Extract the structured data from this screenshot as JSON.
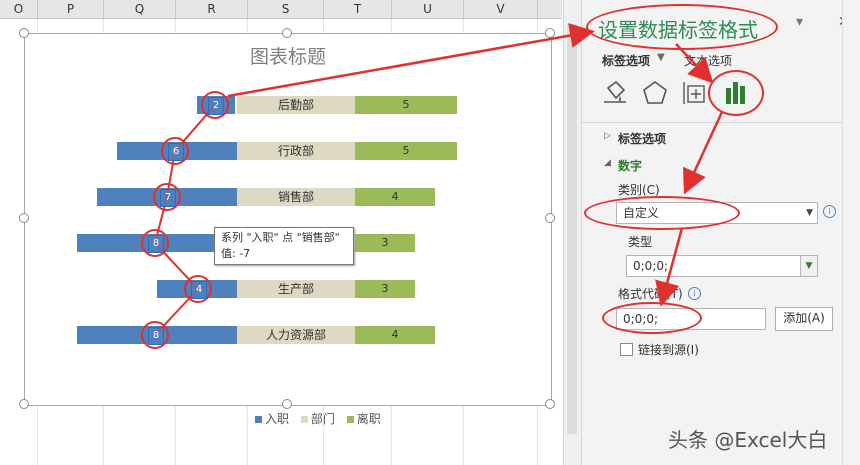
{
  "columns": [
    "O",
    "P",
    "Q",
    "R",
    "S",
    "T",
    "U",
    "V"
  ],
  "chart": {
    "title": "图表标题",
    "departments": [
      "后勤部",
      "行政部",
      "销售部",
      "生产部",
      "人力资源部"
    ],
    "rows": [
      {
        "dept": "后勤部",
        "join": 2,
        "leave": 5
      },
      {
        "dept": "行政部",
        "join": 6,
        "leave": 5
      },
      {
        "dept": "销售部",
        "join": 7,
        "leave": 4
      },
      {
        "dept": "",
        "join": 8,
        "leave": 3
      },
      {
        "dept": "生产部",
        "join": 4,
        "leave": 3
      },
      {
        "dept": "人力资源部",
        "join": 8,
        "leave": 4
      }
    ],
    "legend": [
      "入职",
      "部门",
      "离职"
    ],
    "tooltip_line1": "系列 \"入职\" 点 \"销售部\"",
    "tooltip_line2": "值: -7"
  },
  "chart_data": {
    "type": "bar",
    "title": "图表标题",
    "categories": [
      "后勤部",
      "行政部",
      "销售部",
      "",
      "生产部",
      "人力资源部"
    ],
    "series": [
      {
        "name": "入职",
        "values": [
          -2,
          -6,
          -7,
          -8,
          -4,
          -8
        ]
      },
      {
        "name": "离职",
        "values": [
          5,
          5,
          4,
          3,
          3,
          4
        ]
      }
    ]
  },
  "panel": {
    "title": "设置数据标签格式",
    "tab_label_options": "标签选项",
    "tab_text_options": "文本选项",
    "section_label_options": "标签选项",
    "section_number": "数字",
    "category_label": "类别(C)",
    "category_value": "自定义",
    "type_label": "类型",
    "type_value": "0;0;0;",
    "format_code_label": "格式代码(T)",
    "format_code_value": "0;0;0;",
    "add_button": "添加(A)",
    "link_source": "链接到源(I)",
    "close": "✕",
    "pin": "▾"
  },
  "watermark": "头条 @Excel大白",
  "colors": {
    "blue": "#4f81bd",
    "tan": "#ddd9c3",
    "green": "#9bbb59",
    "annotation": "#e03030",
    "panel_title": "#2e8b57"
  }
}
